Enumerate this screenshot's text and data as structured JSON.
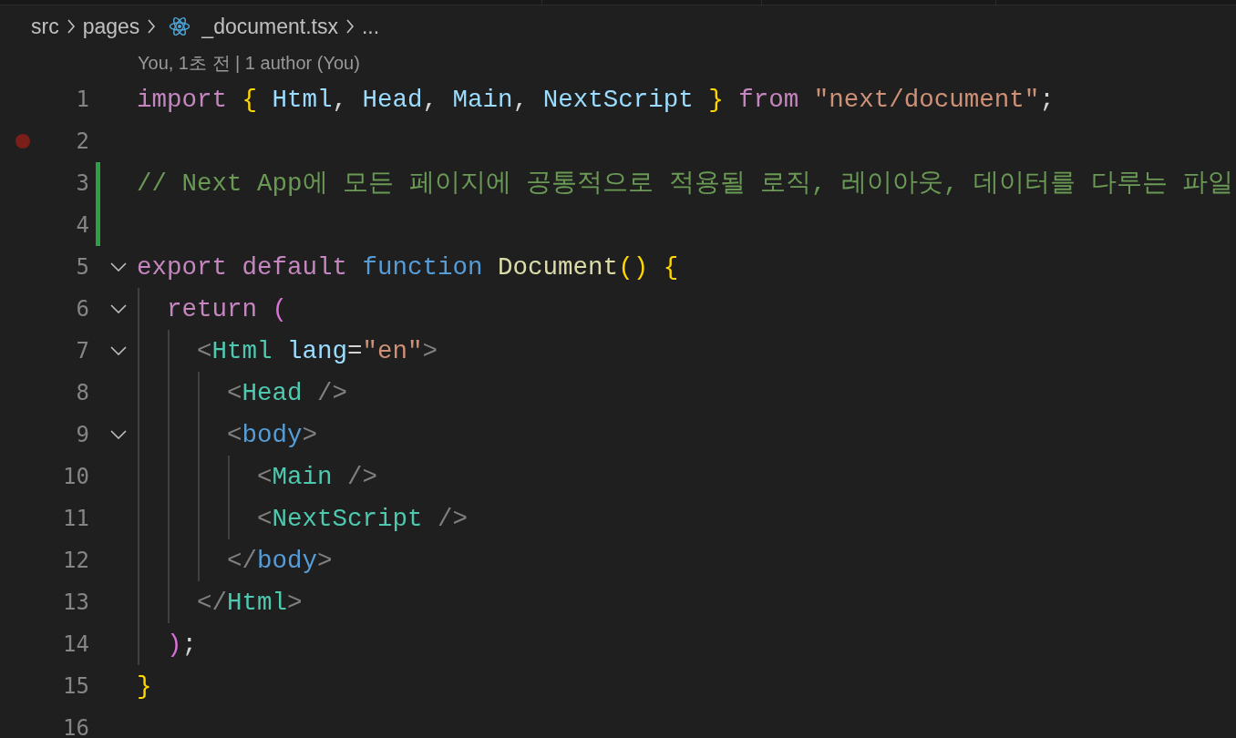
{
  "breadcrumb": [
    {
      "label": "src",
      "kind": "folder"
    },
    {
      "label": "pages",
      "kind": "folder"
    },
    {
      "label": "_document.tsx",
      "kind": "file"
    },
    {
      "label": "...",
      "kind": "more"
    }
  ],
  "codelens": "You, 1초 전 | 1 author (You)",
  "lines": [
    {
      "number": "1",
      "fold": false,
      "breakpoint": false,
      "modified": false,
      "tokens": [
        {
          "text": "import",
          "color": "#c586c0"
        },
        {
          "text": " {",
          "color": "#ffd700"
        },
        {
          "text": " Html",
          "color": "#9cdcfe"
        },
        {
          "text": ", ",
          "color": "#d4d4d4"
        },
        {
          "text": "Head",
          "color": "#9cdcfe"
        },
        {
          "text": ", ",
          "color": "#d4d4d4"
        },
        {
          "text": "Main",
          "color": "#9cdcfe"
        },
        {
          "text": ", ",
          "color": "#d4d4d4"
        },
        {
          "text": "NextScript ",
          "color": "#9cdcfe"
        },
        {
          "text": "}",
          "color": "#ffd700"
        },
        {
          "text": " from",
          "color": "#c586c0"
        },
        {
          "text": " \"next/document\"",
          "color": "#ce9178"
        },
        {
          "text": ";",
          "color": "#d4d4d4"
        }
      ]
    },
    {
      "number": "2",
      "fold": false,
      "breakpoint": true,
      "modified": false
    },
    {
      "number": "3",
      "fold": false,
      "breakpoint": false,
      "modified": true,
      "tokens": [
        {
          "text": "// Next App에 모든 페이지에 공통적으로 적용될 로직, 레이아웃, 데이터를 다루는 파일",
          "color": "#6a9955"
        }
      ]
    },
    {
      "number": "4",
      "fold": false,
      "breakpoint": false,
      "modified": true
    },
    {
      "number": "5",
      "fold": true,
      "breakpoint": false,
      "modified": false,
      "tokens": [
        {
          "text": "export",
          "color": "#c586c0"
        },
        {
          "text": " default",
          "color": "#c586c0"
        },
        {
          "text": " function",
          "color": "#569cd6"
        },
        {
          "text": " Document",
          "color": "#dcdcaa"
        },
        {
          "text": "()",
          "color": "#ffd700"
        },
        {
          "text": " {",
          "color": "#ffd700"
        }
      ]
    },
    {
      "number": "6",
      "fold": true,
      "breakpoint": false,
      "modified": false,
      "tokens": [
        {
          "text": "  return",
          "color": "#c586c0"
        },
        {
          "text": " (",
          "color": "#da70d6"
        }
      ]
    },
    {
      "number": "7",
      "fold": true,
      "breakpoint": false,
      "modified": false,
      "tokens": [
        {
          "text": "    <",
          "color": "#808080"
        },
        {
          "text": "Html",
          "color": "#4ec9b0"
        },
        {
          "text": " lang",
          "color": "#9cdcfe"
        },
        {
          "text": "=",
          "color": "#d4d4d4"
        },
        {
          "text": "\"en\"",
          "color": "#ce9178"
        },
        {
          "text": ">",
          "color": "#808080"
        }
      ]
    },
    {
      "number": "8",
      "fold": false,
      "breakpoint": false,
      "modified": false,
      "tokens": [
        {
          "text": "      <",
          "color": "#808080"
        },
        {
          "text": "Head",
          "color": "#4ec9b0"
        },
        {
          "text": " />",
          "color": "#808080"
        }
      ]
    },
    {
      "number": "9",
      "fold": true,
      "breakpoint": false,
      "modified": false,
      "tokens": [
        {
          "text": "      <",
          "color": "#808080"
        },
        {
          "text": "body",
          "color": "#569cd6"
        },
        {
          "text": ">",
          "color": "#808080"
        }
      ]
    },
    {
      "number": "10",
      "fold": false,
      "breakpoint": false,
      "modified": false,
      "tokens": [
        {
          "text": "        <",
          "color": "#808080"
        },
        {
          "text": "Main",
          "color": "#4ec9b0"
        },
        {
          "text": " />",
          "color": "#808080"
        }
      ]
    },
    {
      "number": "11",
      "fold": false,
      "breakpoint": false,
      "modified": false,
      "tokens": [
        {
          "text": "        <",
          "color": "#808080"
        },
        {
          "text": "NextScript",
          "color": "#4ec9b0"
        },
        {
          "text": " />",
          "color": "#808080"
        }
      ]
    },
    {
      "number": "12",
      "fold": false,
      "breakpoint": false,
      "modified": false,
      "tokens": [
        {
          "text": "      </",
          "color": "#808080"
        },
        {
          "text": "body",
          "color": "#569cd6"
        },
        {
          "text": ">",
          "color": "#808080"
        }
      ]
    },
    {
      "number": "13",
      "fold": false,
      "breakpoint": false,
      "modified": false,
      "tokens": [
        {
          "text": "    </",
          "color": "#808080"
        },
        {
          "text": "Html",
          "color": "#4ec9b0"
        },
        {
          "text": ">",
          "color": "#808080"
        }
      ]
    },
    {
      "number": "14",
      "fold": false,
      "breakpoint": false,
      "modified": false,
      "tokens": [
        {
          "text": "  )",
          "color": "#da70d6"
        },
        {
          "text": ";",
          "color": "#d4d4d4"
        }
      ]
    },
    {
      "number": "15",
      "fold": false,
      "breakpoint": false,
      "modified": false,
      "tokens": [
        {
          "text": "}",
          "color": "#ffd700"
        }
      ]
    },
    {
      "number": "16",
      "fold": false,
      "breakpoint": false,
      "modified": false
    }
  ]
}
